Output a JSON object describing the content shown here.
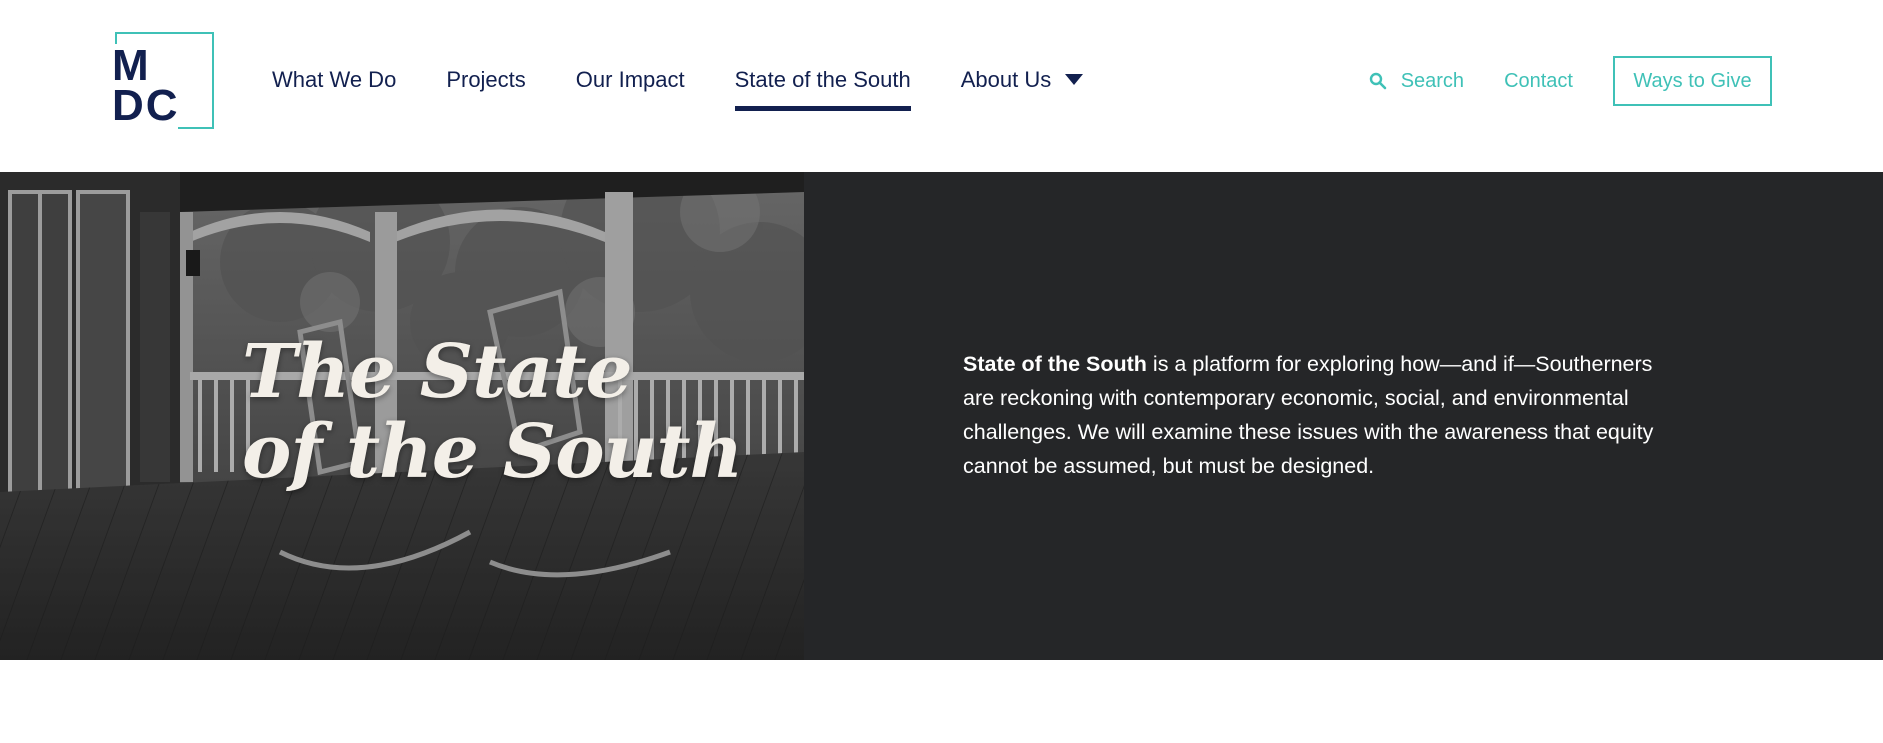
{
  "logo": {
    "line1": "M",
    "line2": "DC"
  },
  "nav": {
    "items": [
      {
        "label": "What We Do"
      },
      {
        "label": "Projects"
      },
      {
        "label": "Our Impact"
      },
      {
        "label": "State of the South"
      },
      {
        "label": "About Us"
      }
    ],
    "active": "State of the South"
  },
  "util": {
    "search_label": "Search",
    "contact_label": "Contact",
    "give_label": "Ways to Give"
  },
  "hero": {
    "title_line1": "The State",
    "title_line2": "of the South",
    "intro_bold": "State of the South",
    "intro_rest": " is a platform for exploring how—and if—Southerners are reckoning with contemporary economic, social, and environmental challenges. We will examine these issues with the awareness that equity cannot be assumed, but must be designed."
  },
  "colors": {
    "navy": "#12204f",
    "teal": "#3fc1b7",
    "hero_bg": "#252628",
    "title_cream": "#f3efe8"
  }
}
